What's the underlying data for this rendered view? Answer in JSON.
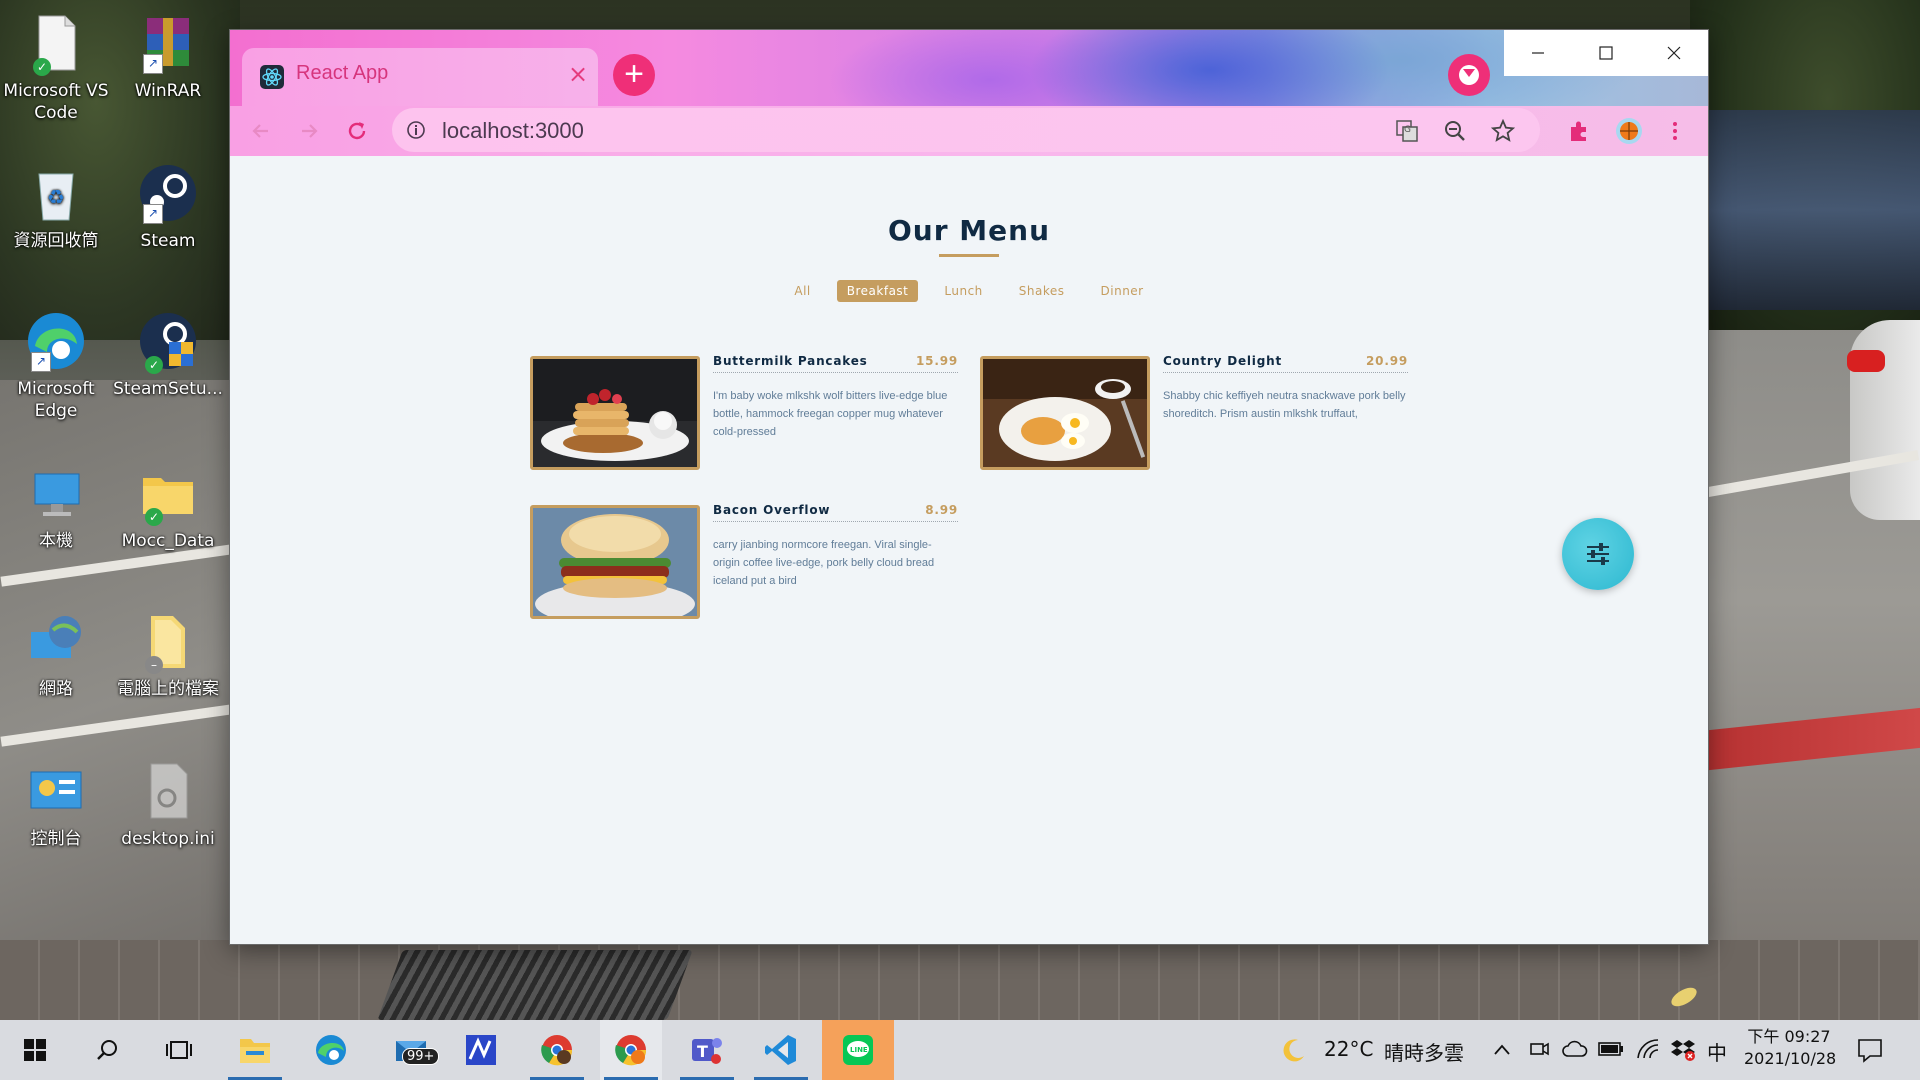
{
  "desktop": {
    "icons": [
      {
        "label": "Microsoft VS Code"
      },
      {
        "label": "WinRAR"
      },
      {
        "label": "資源回收筒"
      },
      {
        "label": "Steam"
      },
      {
        "label": "Microsoft Edge"
      },
      {
        "label": "SteamSetu..."
      },
      {
        "label": "本機"
      },
      {
        "label": "Mocc_Data"
      },
      {
        "label": "網路"
      },
      {
        "label": "電腦上的檔案"
      },
      {
        "label": "控制台"
      },
      {
        "label": "desktop.ini"
      }
    ]
  },
  "browser": {
    "tab_title": "React App",
    "tab_close": "×",
    "new_tab": "+",
    "url": "localhost:3000",
    "accent": "#ef2f78"
  },
  "page": {
    "title": "Our Menu",
    "accent_color": "#c59d5f",
    "filters": [
      "All",
      "Breakfast",
      "Lunch",
      "Shakes",
      "Dinner"
    ],
    "active_filter": "Breakfast",
    "items": [
      {
        "name": "Buttermilk Pancakes",
        "price": "15.99",
        "desc": "I'm baby woke mlkshk wolf bitters live-edge blue bottle, hammock freegan copper mug whatever cold-pressed"
      },
      {
        "name": "Country Delight",
        "price": "20.99",
        "desc": "Shabby chic keffiyeh neutra snackwave pork belly shoreditch. Prism austin mlkshk truffaut,"
      },
      {
        "name": "Bacon Overflow",
        "price": "8.99",
        "desc": "carry jianbing normcore freegan. Viral single-origin coffee live-edge, pork belly cloud bread iceland put a bird"
      }
    ]
  },
  "taskbar": {
    "mail_badge": "99+",
    "weather_temp": "22°C",
    "weather_desc": "晴時多雲",
    "ime": "中",
    "time": "下午 09:27",
    "date": "2021/10/28"
  }
}
